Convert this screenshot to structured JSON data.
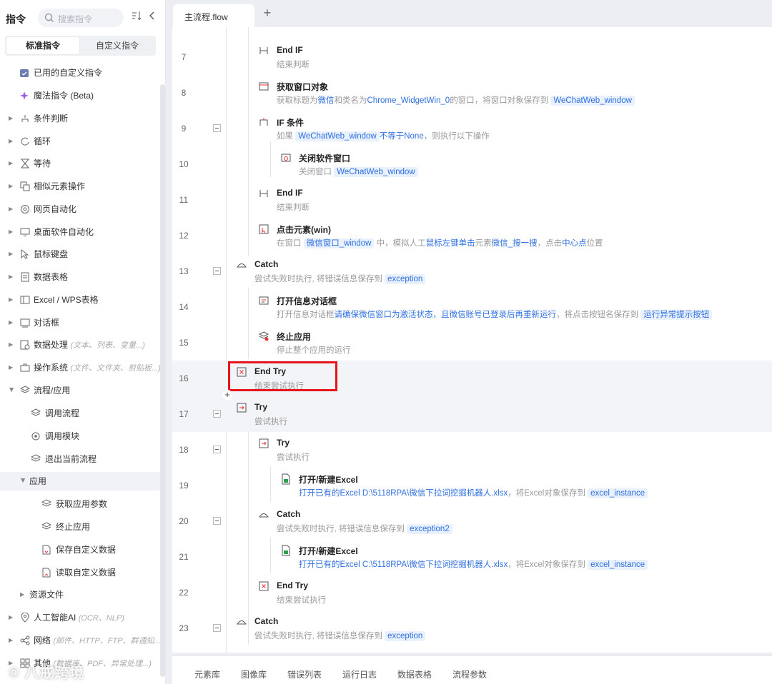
{
  "sidebar": {
    "title": "指令",
    "search_placeholder": "搜索指令",
    "tabs": [
      "标准指令",
      "自定义指令"
    ],
    "items": [
      {
        "label": "已用的自定义指令"
      },
      {
        "label": "魔法指令 (Beta)"
      },
      {
        "label": "条件判断"
      },
      {
        "label": "循环"
      },
      {
        "label": "等待"
      },
      {
        "label": "相似元素操作"
      },
      {
        "label": "网页自动化"
      },
      {
        "label": "桌面软件自动化"
      },
      {
        "label": "鼠标键盘"
      },
      {
        "label": "数据表格"
      },
      {
        "label": "Excel / WPS表格"
      },
      {
        "label": "对话框"
      },
      {
        "label": "数据处理",
        "hint": "(文本、列表、变量...)"
      },
      {
        "label": "操作系统",
        "hint": "(文件、文件夹、剪贴板...)"
      },
      {
        "label": "流程/应用"
      },
      {
        "label": "调用流程"
      },
      {
        "label": "调用模块"
      },
      {
        "label": "退出当前流程"
      },
      {
        "label": "应用"
      },
      {
        "label": "获取应用参数"
      },
      {
        "label": "终止应用"
      },
      {
        "label": "保存自定义数据"
      },
      {
        "label": "读取自定义数据"
      },
      {
        "label": "资源文件"
      },
      {
        "label": "人工智能AI",
        "hint": "(OCR、NLP)"
      },
      {
        "label": "网络",
        "hint": "(邮件、HTTP、FTP、群通知...)"
      },
      {
        "label": "其他",
        "hint": "(数据库、PDF、异常处理...)"
      }
    ]
  },
  "tabs": {
    "file_tab": "主流程.flow",
    "add": "+"
  },
  "flow": {
    "lines": [
      "7",
      "8",
      "9",
      "10",
      "11",
      "12",
      "13",
      "14",
      "15",
      "16",
      "17",
      "18",
      "19",
      "20",
      "21",
      "22",
      "23"
    ],
    "steps": [
      {
        "title": "End IF",
        "desc": "结束判断"
      },
      {
        "title": "获取窗口对象",
        "desc_a": "获取标题为",
        "desc_b": "微信",
        "desc_c": "和类名为",
        "desc_d": "Chrome_WidgetWin_0",
        "desc_e": "的窗口，将窗口对象保存到",
        "var": "WeChatWeb_window"
      },
      {
        "title": "IF 条件",
        "desc_a": "如果",
        "var": "WeChatWeb_window",
        "desc_b": "不等于None",
        "desc_c": "，则执行以下操作"
      },
      {
        "title": "关闭软件窗口",
        "desc_a": "关闭窗口",
        "var": "WeChatWeb_window"
      },
      {
        "title": "End IF",
        "desc": "结束判断"
      },
      {
        "title": "点击元素(win)",
        "desc_a": "在窗口",
        "var": "微信窗口_window",
        "desc_b": "中，模拟人工",
        "desc_c": "鼠标左键单击",
        "desc_d": "元素",
        "desc_e": "微信_搜一搜",
        "desc_f": "，点击",
        "desc_g": "中心点",
        "desc_h": "位置"
      },
      {
        "title": "Catch",
        "desc_a": "尝试失败时执行, 将错误信息保存到",
        "var": "exception"
      },
      {
        "title": "打开信息对话框",
        "desc_a": "打开信息对话框",
        "desc_b": "请确保微信窗口为激活状态，且微信账号已登录后再重新运行",
        "desc_c": "，将点击按钮名保存到",
        "var": "运行异常提示按钮"
      },
      {
        "title": "终止应用",
        "desc": "停止整个应用的运行"
      },
      {
        "title": "End Try",
        "desc": "结束尝试执行"
      },
      {
        "title": "Try",
        "desc": "尝试执行"
      },
      {
        "title": "Try",
        "desc": "尝试执行"
      },
      {
        "title": "打开/新建Excel",
        "desc_a": "打开已有的Excel D:\\5118RPA\\微信下拉词挖掘机器人.xlsx",
        "desc_b": "，将Excel对象保存到",
        "var": "excel_instance"
      },
      {
        "title": "Catch",
        "desc_a": "尝试失败时执行, 将错误信息保存到",
        "var": "exception2"
      },
      {
        "title": "打开/新建Excel",
        "desc_a": "打开已有的Excel C:\\5118RPA\\微信下拉词挖掘机器人.xlsx",
        "desc_b": "，将Excel对象保存到",
        "var": "excel_instance"
      },
      {
        "title": "End Try",
        "desc": "结束尝试执行"
      },
      {
        "title": "Catch",
        "desc_a": "尝试失败时执行, 将错误信息保存到",
        "var": "exception"
      }
    ]
  },
  "bottom_tabs": [
    "元素库",
    "图像库",
    "错误列表",
    "运行日志",
    "数据表格",
    "流程参数"
  ],
  "watermark": "© 八戒跨境",
  "colors": {
    "accent": "#2f6fe0",
    "highlight_box": "#e6141b",
    "var_bg": "#e8f1fc"
  }
}
